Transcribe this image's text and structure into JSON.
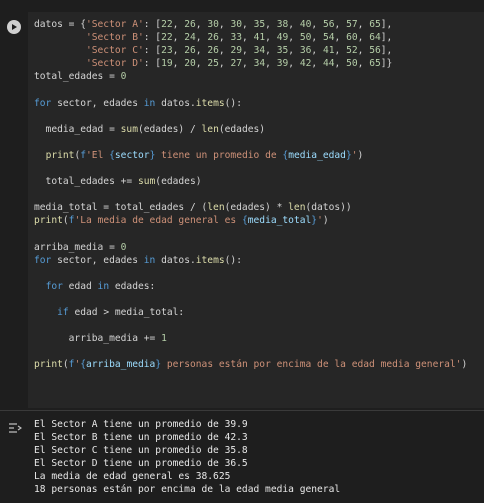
{
  "icons": {
    "run": "play-circle-icon",
    "output_toggle": "output-collapse-icon"
  },
  "colors": {
    "keyword": "#569cd6",
    "function": "#dcdcaa",
    "string": "#ce9178",
    "number": "#b5cea8",
    "background": "#1e1e1e",
    "editor_bg": "#262626"
  },
  "code_lines": [
    "datos = {'Sector A': [22, 26, 30, 30, 35, 38, 40, 56, 57, 65],",
    "         'Sector B': [22, 24, 26, 33, 41, 49, 50, 54, 60, 64],",
    "         'Sector C': [23, 26, 26, 29, 34, 35, 36, 41, 52, 56],",
    "         'Sector D': [19, 20, 25, 27, 34, 39, 42, 44, 50, 65]}",
    "total_edades = 0",
    "",
    "for sector, edades in datos.items():",
    "",
    "  media_edad = sum(edades) / len(edades)",
    "",
    "  print(f'El {sector} tiene un promedio de {media_edad}')",
    "",
    "  total_edades += sum(edades)",
    "",
    "media_total = total_edades / (len(edades) * len(datos))",
    "print(f'La media de edad general es {media_total}')",
    "",
    "arriba_media = 0",
    "for sector, edades in datos.items():",
    "",
    "  for edad in edades:",
    "",
    "    if edad > media_total:",
    "",
    "      arriba_media += 1",
    "",
    "print(f'{arriba_media} personas están por encima de la edad media general')"
  ],
  "output_lines": [
    "El Sector A tiene un promedio de 39.9",
    "El Sector B tiene un promedio de 42.3",
    "El Sector C tiene un promedio de 35.8",
    "El Sector D tiene un promedio de 36.5",
    "La media de edad general es 38.625",
    "18 personas están por encima de la edad media general"
  ]
}
